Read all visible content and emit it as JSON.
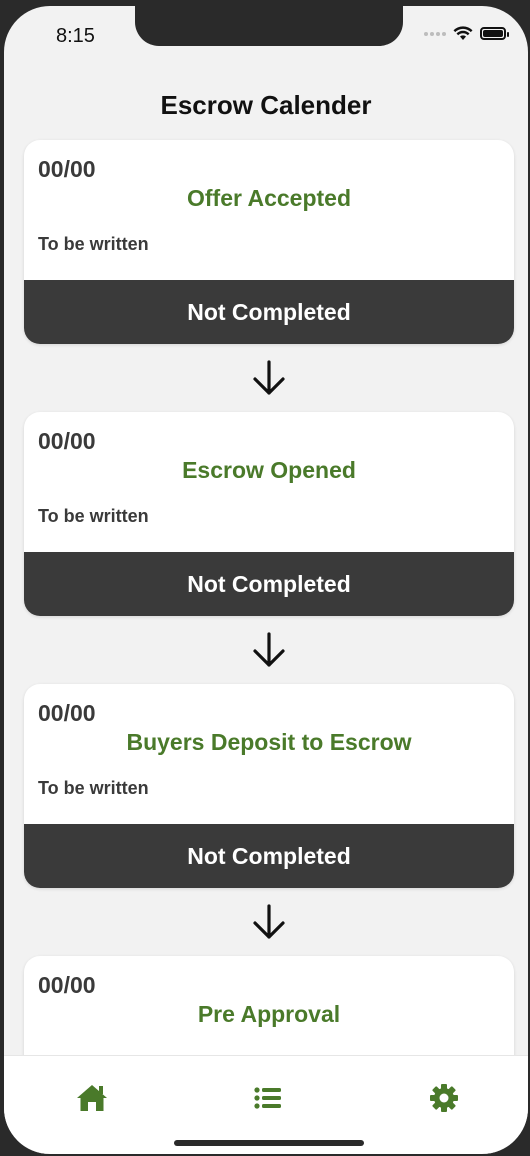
{
  "status_bar": {
    "time": "8:15"
  },
  "header": {
    "title": "Escrow Calender"
  },
  "cards": [
    {
      "date": "00/00",
      "title": "Offer Accepted",
      "description": "To be written",
      "status": "Not Completed"
    },
    {
      "date": "00/00",
      "title": "Escrow Opened",
      "description": "To be written",
      "status": "Not Completed"
    },
    {
      "date": "00/00",
      "title": "Buyers Deposit to Escrow",
      "description": "To be written",
      "status": "Not Completed"
    },
    {
      "date": "00/00",
      "title": "Pre Approval",
      "description": "",
      "status": ""
    }
  ],
  "tab_bar": {
    "items": [
      {
        "icon": "home-icon"
      },
      {
        "icon": "list-icon"
      },
      {
        "icon": "gear-icon"
      }
    ]
  },
  "colors": {
    "accent_green": "#4a7a2a",
    "status_bar_dark": "#3a3a3a",
    "background": "#f2f2f2"
  }
}
